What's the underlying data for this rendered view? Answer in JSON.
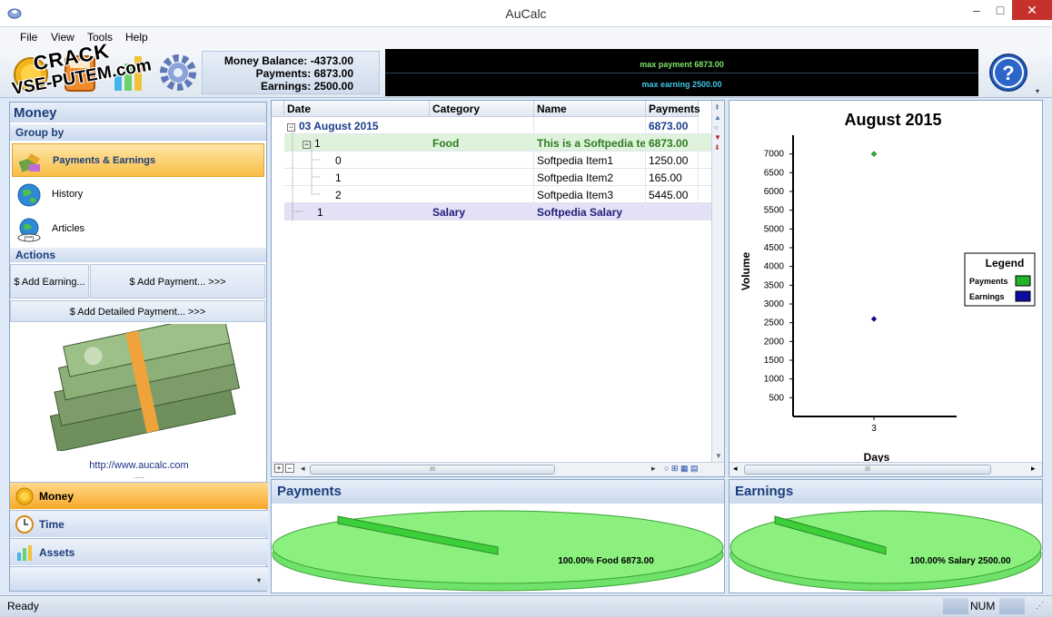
{
  "window": {
    "title": "AuCalc",
    "minimize": "–",
    "maximize": "□",
    "close": "✕"
  },
  "menu": {
    "file": "File",
    "view": "View",
    "tools": "Tools",
    "help": "Help"
  },
  "watermark": {
    "line1": "CRACK",
    "line2": "VSE-PUTEM.com"
  },
  "balances": {
    "money": "Money Balance: -4373.00",
    "payments": "Payments: 6873.00",
    "earnings": "Earnings: 2500.00"
  },
  "ticker": {
    "payment": "max payment 6873.00",
    "earning": "max earning 2500.00"
  },
  "left": {
    "title": "Money",
    "group_by": "Group by",
    "groups": [
      {
        "label": "Payments & Earnings"
      },
      {
        "label": "History"
      },
      {
        "label": "Articles"
      }
    ],
    "actions": "Actions",
    "add_earning": "$ Add Earning...",
    "add_payment": "$ Add Payment... >>>",
    "add_detailed": "$ Add Detailed Payment... >>>",
    "url": "http://www.aucalc.com",
    "nav": [
      {
        "label": "Money"
      },
      {
        "label": "Time"
      },
      {
        "label": "Assets"
      }
    ]
  },
  "grid": {
    "headers": [
      "Date",
      "Category",
      "Name",
      "Payments"
    ],
    "rows": [
      {
        "c1": "03 August 2015",
        "c2": "",
        "c3": "",
        "c4": "6873.00"
      },
      {
        "c1": "1",
        "c2": "Food",
        "c3": "This is a Softpedia test",
        "c4": "6873.00"
      },
      {
        "c1": "0",
        "c2": "",
        "c3": "Softpedia Item1",
        "c4": "1250.00"
      },
      {
        "c1": "1",
        "c2": "",
        "c3": "Softpedia Item2",
        "c4": "165.00"
      },
      {
        "c1": "2",
        "c2": "",
        "c3": "Softpedia Item3",
        "c4": "5445.00"
      },
      {
        "c1": "1",
        "c2": "Salary",
        "c3": "Softpedia Salary",
        "c4": ""
      }
    ],
    "hscroll_mid": "III"
  },
  "chart_data": {
    "type": "scatter",
    "title": "August 2015",
    "xlabel": "Days",
    "ylabel": "Volume",
    "ylim": [
      0,
      7500
    ],
    "yticks": [
      500,
      1000,
      1500,
      2000,
      2500,
      3000,
      3500,
      4000,
      4500,
      5000,
      5500,
      6000,
      6500,
      7000
    ],
    "xticks": [
      "3"
    ],
    "legend_title": "Legend",
    "legend_position": "right",
    "series": [
      {
        "name": "Payments",
        "color": "#22b22c",
        "x": [
          3
        ],
        "y": [
          7000
        ]
      },
      {
        "name": "Earnings",
        "color": "#0c0ca0",
        "x": [
          3
        ],
        "y": [
          2600
        ]
      }
    ],
    "hscroll_mid": "III"
  },
  "pies": {
    "payments": {
      "title": "Payments",
      "label": "100.00% Food 6873.00"
    },
    "earnings": {
      "title": "Earnings",
      "label": "100.00% Salary 2500.00"
    }
  },
  "status": {
    "text": "Ready",
    "num": "NUM"
  }
}
